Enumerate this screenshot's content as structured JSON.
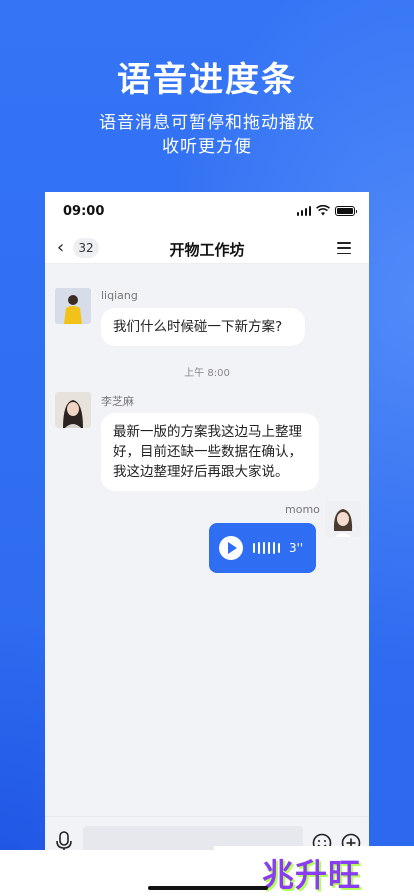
{
  "promo": {
    "headline": "语音进度条",
    "subline_1": "语音消息可暂停和拖动播放",
    "subline_2": "收听更方便"
  },
  "status_bar": {
    "time": "09:00"
  },
  "nav": {
    "back_icon": "chevron-left",
    "unread_badge": "32",
    "title": "开物工作坊",
    "menu_icon": "hamburger-menu"
  },
  "messages": [
    {
      "sender": "liqiang",
      "text": "我们什么时候碰一下新方案?"
    },
    {
      "timestamp": "上午 8:00"
    },
    {
      "sender": "李芝麻",
      "lines": [
        "最新一版的方案我这边马上整理",
        "好，目前还缺一些数据在确认，",
        "我这边整理好后再跟大家说。"
      ]
    },
    {
      "sender": "momo",
      "voice_duration": "3''"
    }
  ],
  "input_bar": {
    "mic_icon": "microphone",
    "emoji_icon": "smiley",
    "plus_icon": "plus-circle"
  },
  "watermark": {
    "text": "兆升旺"
  },
  "colors": {
    "accent": "#2f6df2",
    "background": "#f2f3f7"
  }
}
